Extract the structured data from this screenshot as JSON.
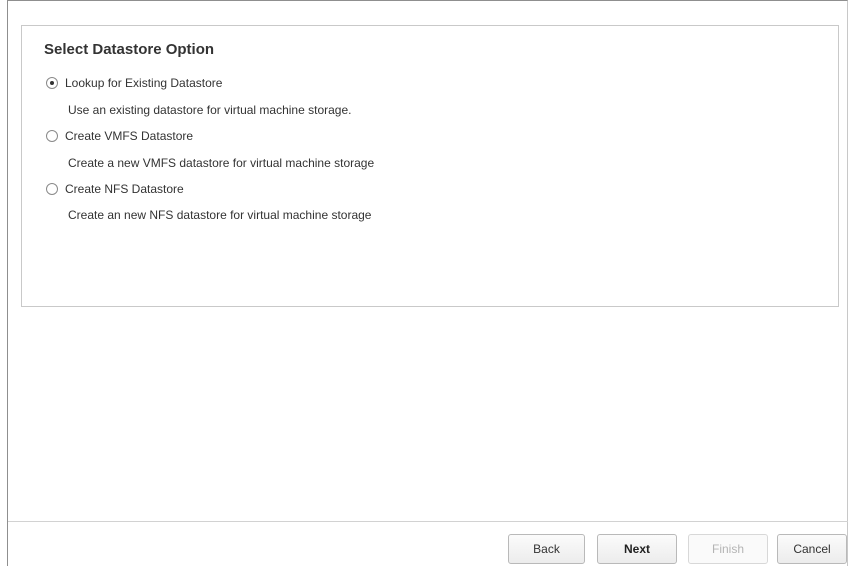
{
  "section": {
    "title": "Select Datastore Option"
  },
  "options": [
    {
      "label": "Lookup for Existing Datastore",
      "description": "Use an existing datastore for virtual machine storage.",
      "selected": true
    },
    {
      "label": "Create VMFS Datastore",
      "description": "Create a new VMFS datastore for virtual machine storage",
      "selected": false
    },
    {
      "label": "Create NFS Datastore",
      "description": "Create an new NFS datastore for virtual machine storage",
      "selected": false
    }
  ],
  "footer": {
    "back_label": "Back",
    "next_label": "Next",
    "finish_label": "Finish",
    "cancel_label": "Cancel",
    "finish_enabled": false
  }
}
